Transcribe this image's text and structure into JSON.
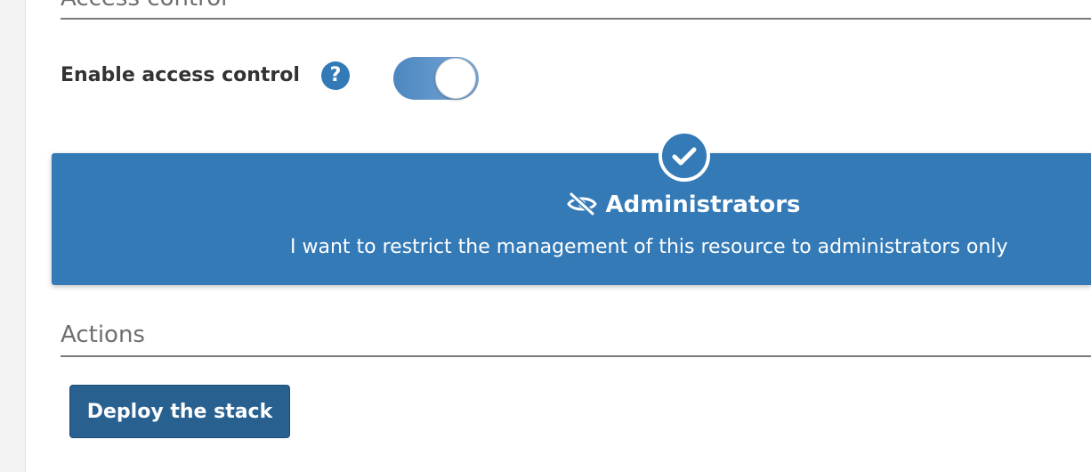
{
  "access_control": {
    "section_title": "Access control",
    "enable_label": "Enable access control",
    "help_glyph": "?",
    "toggle_enabled": true
  },
  "ownership_option": {
    "selected": true,
    "icon": "eye-slash-icon",
    "title": "Administrators",
    "description": "I want to restrict the management of this resource to administrators only"
  },
  "actions": {
    "section_title": "Actions",
    "deploy_label": "Deploy the stack"
  },
  "colors": {
    "primary": "#337ab7",
    "button": "#286090",
    "heading": "#6f6f6f",
    "text": "#333333"
  }
}
